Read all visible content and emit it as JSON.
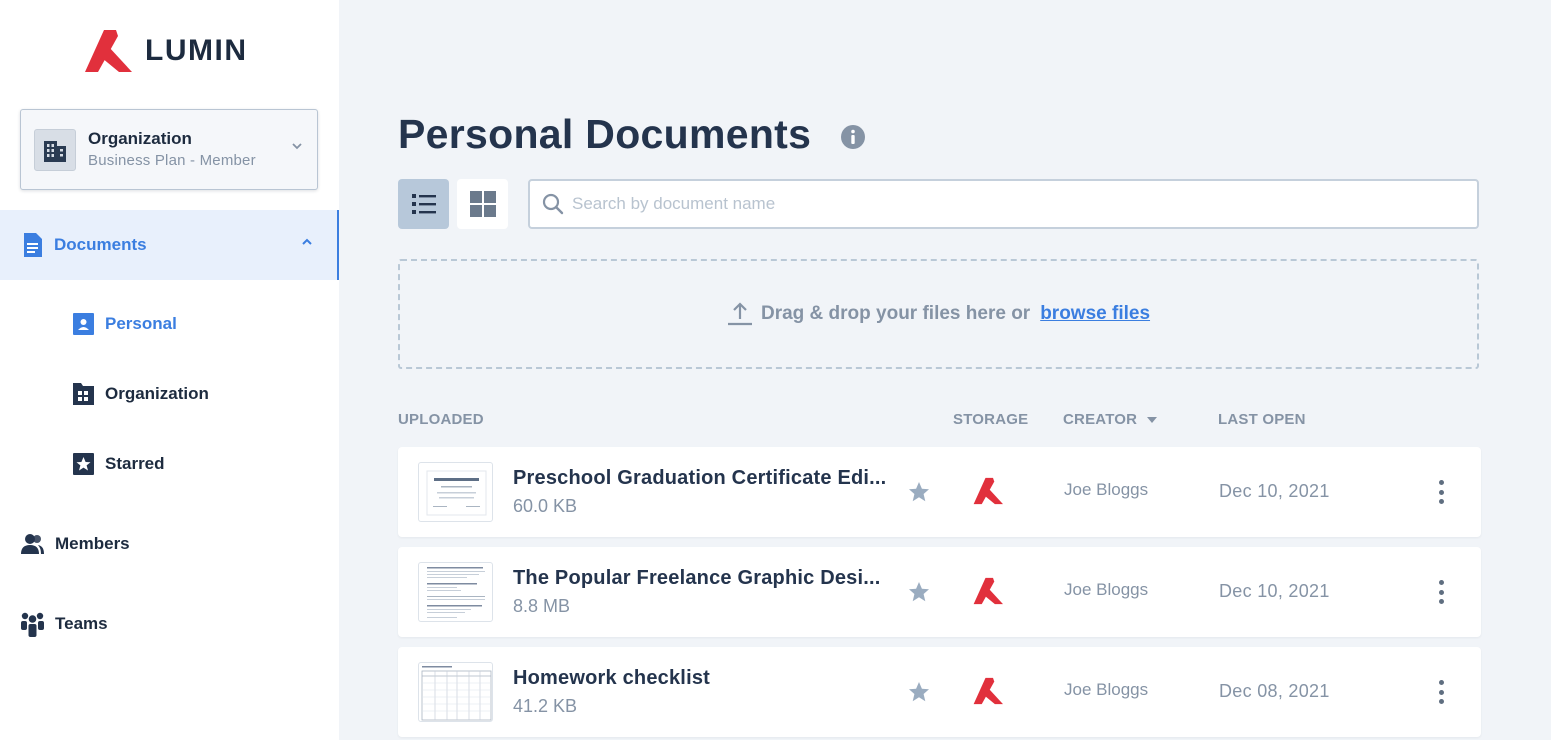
{
  "brand": {
    "name": "LUMIN",
    "accent": "#e1303c"
  },
  "org_switcher": {
    "name": "Organization",
    "plan": "Business Plan - Member"
  },
  "sidebar": {
    "documents_label": "Documents",
    "sub_items": [
      {
        "label": "Personal",
        "icon": "personal-doc-icon",
        "active": true
      },
      {
        "label": "Organization",
        "icon": "org-folder-icon",
        "active": false
      },
      {
        "label": "Starred",
        "icon": "starred-icon",
        "active": false
      }
    ],
    "items": [
      {
        "label": "Members",
        "icon": "members-icon"
      },
      {
        "label": "Teams",
        "icon": "teams-icon"
      }
    ]
  },
  "main": {
    "title": "Personal Documents",
    "search_placeholder": "Search by document name",
    "dropzone_text": "Drag & drop your files here or",
    "dropzone_link": "browse files",
    "columns": {
      "uploaded": "UPLOADED",
      "storage": "STORAGE",
      "creator": "CREATOR",
      "last_open": "LAST OPEN"
    },
    "documents": [
      {
        "name": "Preschool Graduation Certificate Edi...",
        "size": "60.0 KB",
        "creator": "Joe Bloggs",
        "last_open": "Dec 10, 2021",
        "thumb": "certificate"
      },
      {
        "name": "The Popular Freelance Graphic Desi...",
        "size": "8.8 MB",
        "creator": "Joe Bloggs",
        "last_open": "Dec 10, 2021",
        "thumb": "text"
      },
      {
        "name": "Homework checklist",
        "size": "41.2 KB",
        "creator": "Joe Bloggs",
        "last_open": "Dec 08, 2021",
        "thumb": "table"
      }
    ]
  },
  "colors": {
    "primary": "#3b7ee0",
    "muted": "#8593a5",
    "dark": "#1d2b3f"
  }
}
